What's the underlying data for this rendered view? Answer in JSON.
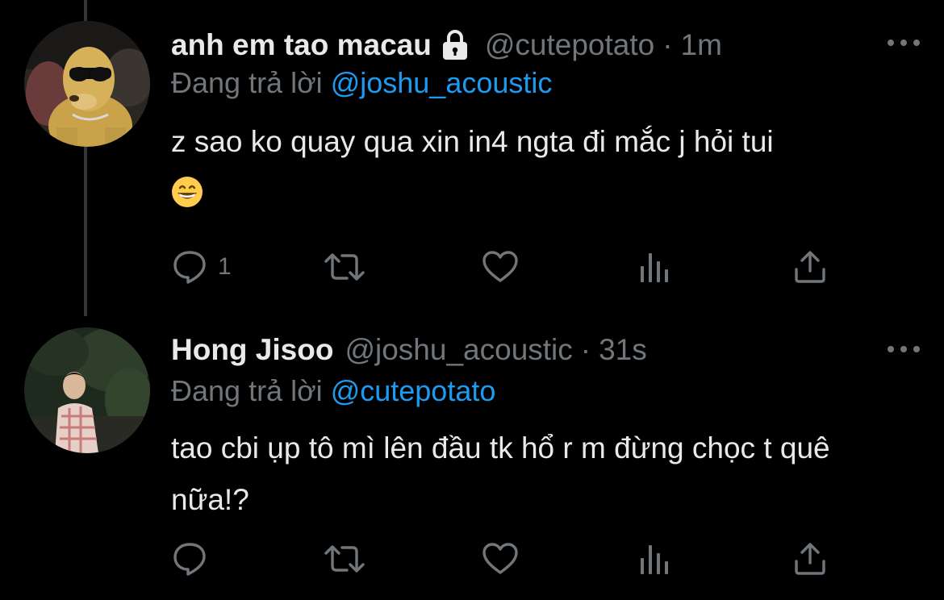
{
  "colors": {
    "background": "#000000",
    "text_primary": "#e7e9ea",
    "text_secondary": "#71767b",
    "accent": "#1d9bf0",
    "thread_line": "#333639"
  },
  "tweets": [
    {
      "display_name": "anh em tao macau",
      "protected_icon": "lock-icon",
      "handle": "@cutepotato",
      "separator": "·",
      "time": "1m",
      "reply_prefix": "Đang trả lời",
      "reply_to": "@joshu_acoustic",
      "text": "z sao ko quay qua xin in4 ngta đi mắc j hỏi tui",
      "emoji": "grinning-face-emoji",
      "actions": {
        "reply_count": "1",
        "retweet_count": "",
        "like_count": ""
      }
    },
    {
      "display_name": "Hong Jisoo",
      "handle": "@joshu_acoustic",
      "separator": "·",
      "time": "31s",
      "reply_prefix": "Đang trả lời",
      "reply_to": "@cutepotato",
      "text": "tao cbi ụp tô mì lên đầu tk hổ r m đừng chọc t quê nữa!?",
      "actions": {
        "reply_count": "",
        "retweet_count": "",
        "like_count": ""
      }
    }
  ]
}
